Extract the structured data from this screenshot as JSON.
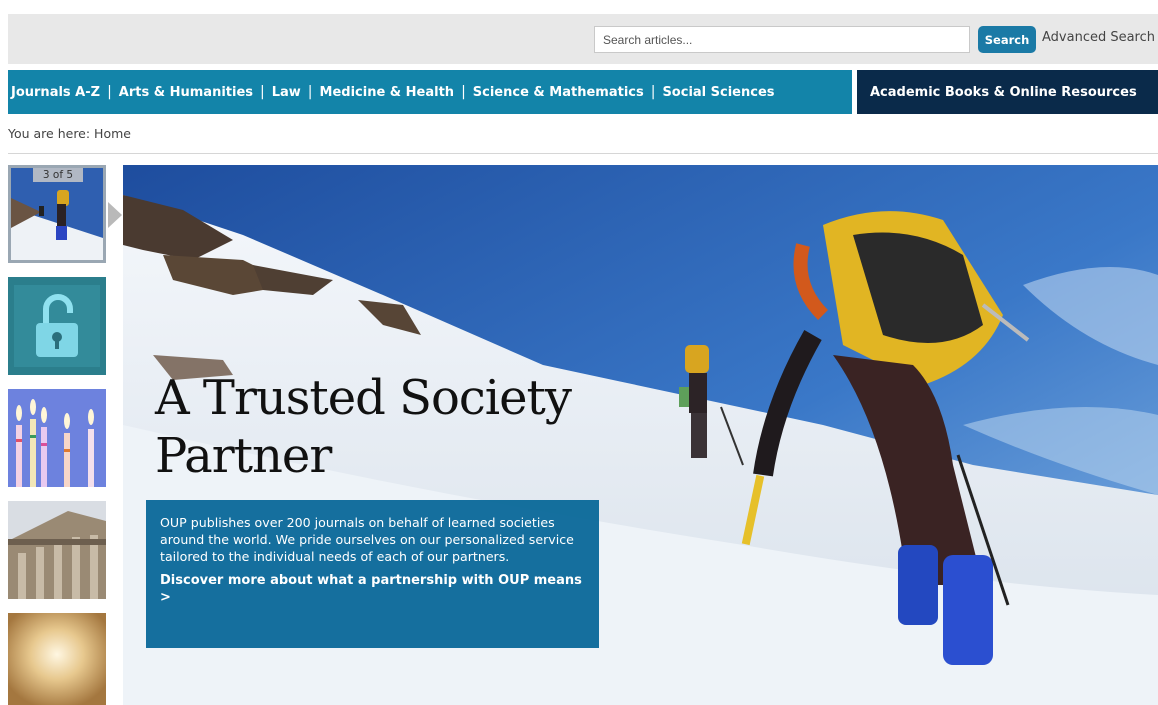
{
  "search": {
    "placeholder": "Search articles...",
    "button_label": "Search",
    "advanced_label": "Advanced Search"
  },
  "nav": {
    "items": [
      {
        "label": "Journals A-Z"
      },
      {
        "label": "Arts & Humanities"
      },
      {
        "label": "Law"
      },
      {
        "label": "Medicine & Health"
      },
      {
        "label": "Science & Mathematics"
      },
      {
        "label": "Social Sciences"
      }
    ],
    "separator": "|",
    "dark_item": "Academic Books & Online Resources"
  },
  "breadcrumb": "You are here: Home",
  "carousel": {
    "counter": "3 of 5",
    "thumbnails": [
      {
        "icon": "climbers-thumbnail",
        "active": true
      },
      {
        "icon": "padlock-thumbnail",
        "active": false
      },
      {
        "icon": "candles-thumbnail",
        "active": false
      },
      {
        "icon": "building-thumbnail",
        "active": false
      },
      {
        "icon": "sparkle-thumbnail",
        "active": false
      }
    ]
  },
  "hero": {
    "title_line1": "A Trusted Society",
    "title_line2": "Partner",
    "body": "OUP publishes over 200 journals on behalf of learned societies around the world. We pride ourselves on our personalized service tailored to the individual needs of each of our partners.",
    "link": "Discover more about what a partnership with OUP means >"
  },
  "colors": {
    "nav": "#1384a9",
    "nav_dark": "#0a2a4a",
    "search_button": "#1b7aa6",
    "hero_box": "#0264a0"
  }
}
